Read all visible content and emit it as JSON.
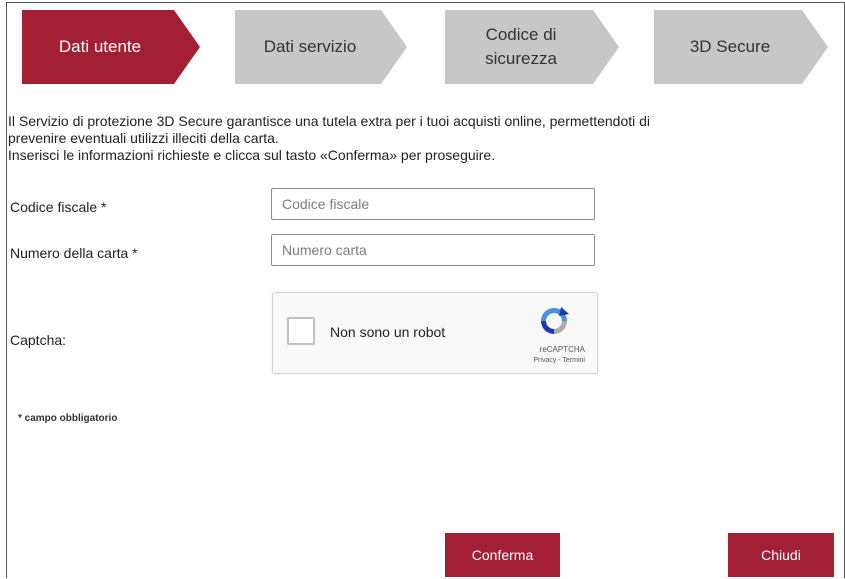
{
  "stepper": {
    "steps": [
      {
        "label": "Dati utente",
        "state": "active"
      },
      {
        "label": "Dati servizio",
        "state": "inactive"
      },
      {
        "label_line1": "Codice di",
        "label_line2": "sicurezza",
        "state": "inactive"
      },
      {
        "label": "3D Secure",
        "state": "inactive"
      }
    ]
  },
  "intro": {
    "line1": "Il Servizio di protezione 3D Secure garantisce una tutela extra per i tuoi acquisti online, permettendoti di",
    "line2": "prevenire eventuali utilizzi illeciti della carta.",
    "line3": "Inserisci le informazioni richieste e clicca sul tasto «Conferma» per proseguire."
  },
  "form": {
    "fiscal_code": {
      "label": "Codice fiscale *",
      "placeholder": "Codice fiscale",
      "value": ""
    },
    "card_number": {
      "label": "Numero della carta *",
      "placeholder": "Numero carta",
      "value": ""
    },
    "captcha": {
      "label": "Captcha:",
      "checkbox_text": "Non sono un robot",
      "brand": "reCAPTCHA",
      "terms": "Privacy - Termini",
      "checked": false
    },
    "required_note": "* campo obbligatorio"
  },
  "buttons": {
    "confirm": "Conferma",
    "close": "Chiudi"
  },
  "colors": {
    "accent": "#a31f34",
    "inactive_step": "#c7c7c7"
  }
}
